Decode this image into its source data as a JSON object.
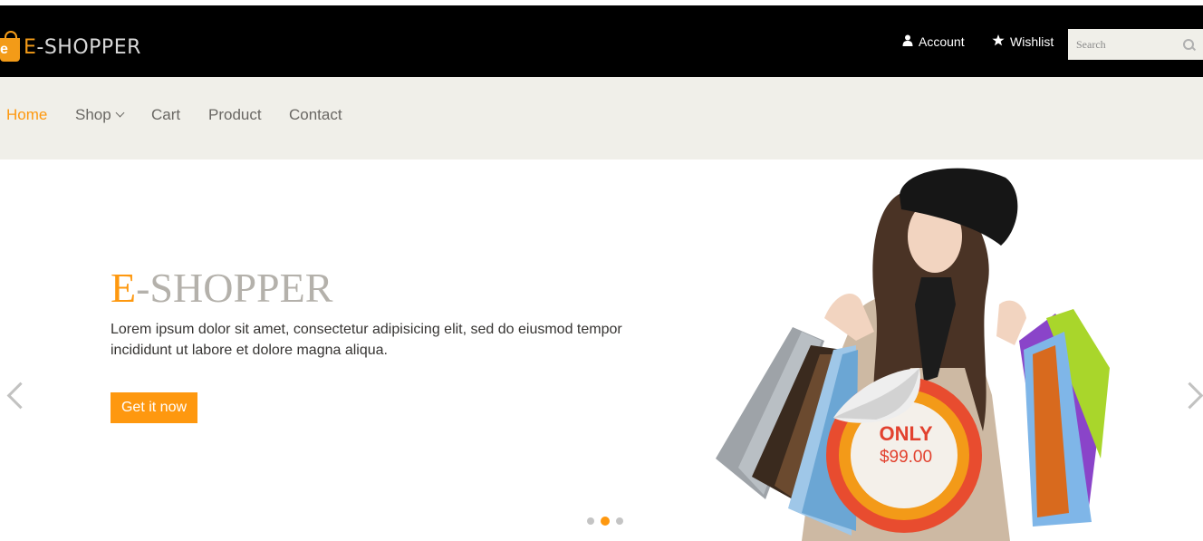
{
  "header": {
    "logo_prefix": "E",
    "logo_rest": "-SHOPPER",
    "logo_bag_letter": "e",
    "account_label": "Account",
    "wishlist_label": "Wishlist",
    "search_placeholder": "Search"
  },
  "nav": {
    "items": [
      {
        "label": "Home",
        "active": true
      },
      {
        "label": "Shop",
        "has_dropdown": true
      },
      {
        "label": "Cart"
      },
      {
        "label": "Product"
      },
      {
        "label": "Contact"
      }
    ]
  },
  "slider": {
    "title_prefix": "E",
    "title_rest": "-SHOPPER",
    "text": "Lorem ipsum dolor sit amet, consectetur adipisicing elit, sed do eiusmod tempor incididunt ut labore et dolore magna aliqua.",
    "cta_label": "Get it now",
    "price_only": "ONLY",
    "price_value": "$99.00",
    "slide_count": 3,
    "active_slide": 2
  },
  "colors": {
    "accent": "#fe980f",
    "header_bg": "#000000",
    "nav_bg": "#f0efe9",
    "price_red": "#e2412e"
  },
  "icons": {
    "account": "user-icon",
    "wishlist": "star-icon",
    "search": "search-icon",
    "prev": "chevron-left-icon",
    "next": "chevron-right-icon"
  }
}
